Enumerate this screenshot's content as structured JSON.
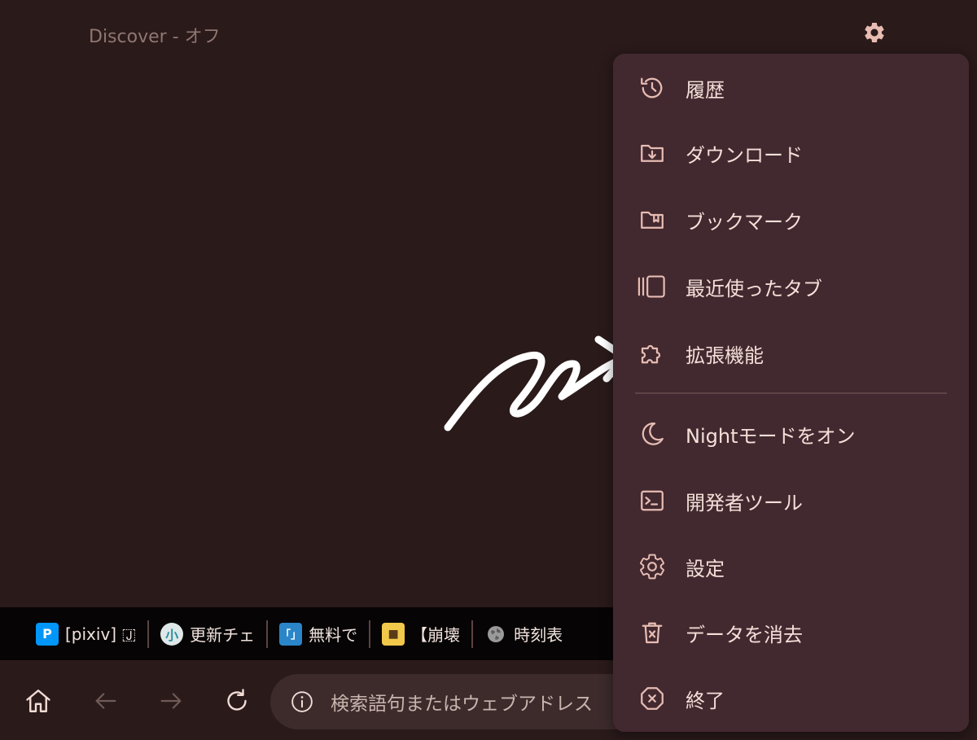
{
  "header": {
    "title": "Discover - オフ",
    "settings_icon": "gear-icon"
  },
  "menu": {
    "items": [
      {
        "label": "履歴",
        "icon": "history-icon"
      },
      {
        "label": "ダウンロード",
        "icon": "download-folder-icon"
      },
      {
        "label": "ブックマーク",
        "icon": "bookmark-folder-icon"
      },
      {
        "label": "最近使ったタブ",
        "icon": "recent-tabs-icon"
      },
      {
        "label": "拡張機能",
        "icon": "puzzle-icon"
      },
      {
        "label": "Nightモードをオン",
        "icon": "moon-icon"
      },
      {
        "label": "開発者ツール",
        "icon": "terminal-icon"
      },
      {
        "label": "設定",
        "icon": "gear-icon"
      },
      {
        "label": "データを消去",
        "icon": "trash-icon"
      },
      {
        "label": "終了",
        "icon": "close-octagon-icon"
      }
    ]
  },
  "tabs": [
    {
      "label": "[pixiv] 🇯",
      "favicon": "pixiv-icon",
      "favicon_text": "P"
    },
    {
      "label": "更新チェ",
      "favicon": "site-icon-1",
      "favicon_text": "小"
    },
    {
      "label": "無料で",
      "favicon": "site-icon-2",
      "favicon_text": "「」"
    },
    {
      "label": "【崩壊",
      "favicon": "site-icon-3",
      "favicon_text": "■"
    },
    {
      "label": "時刻表",
      "favicon": "globe-icon",
      "favicon_text": ""
    }
  ],
  "toolbar": {
    "home_icon": "home-icon",
    "back_icon": "arrow-left-icon",
    "forward_icon": "arrow-right-icon",
    "reload_icon": "reload-icon",
    "url_placeholder": "検索語句またはウェブアドレス",
    "info_icon": "info-icon"
  },
  "colors": {
    "background": "#2a1a1a",
    "menu_background": "#42292f",
    "accent_text": "#f4dfd9",
    "pixiv_blue": "#0096fa"
  }
}
